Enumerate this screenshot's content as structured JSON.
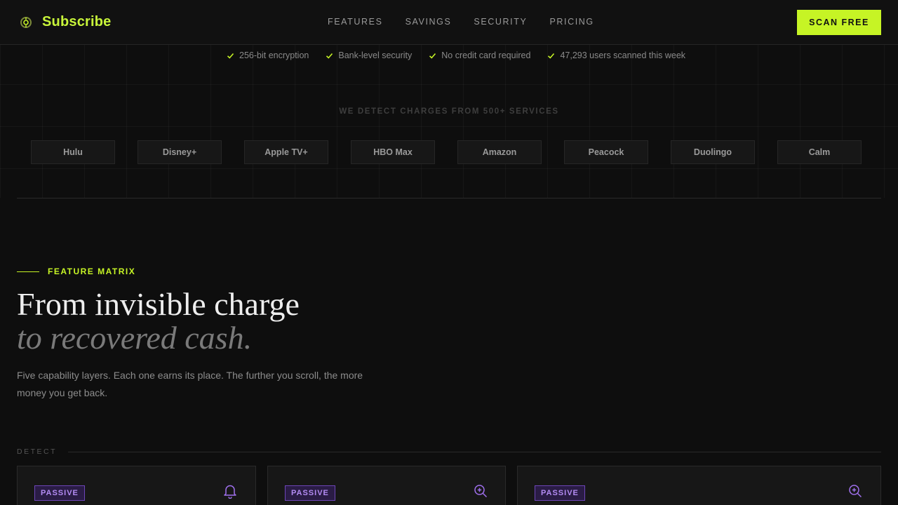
{
  "header": {
    "brand": "Subscribe",
    "nav": [
      "FEATURES",
      "SAVINGS",
      "SECURITY",
      "PRICING"
    ],
    "cta_label": "SCAN FREE"
  },
  "trust": [
    "256-bit encryption",
    "Bank-level security",
    "No credit card required",
    "47,293 users scanned this week"
  ],
  "services": {
    "caption": "WE DETECT CHARGES FROM 500+ SERVICES",
    "items": [
      "Hulu",
      "Disney+",
      "Apple TV+",
      "HBO Max",
      "Amazon",
      "Peacock",
      "Duolingo",
      "Calm"
    ]
  },
  "feature_matrix": {
    "eyebrow": "FEATURE MATRIX",
    "headline_line1": "From invisible charge",
    "headline_line2": "to recovered cash.",
    "subcopy": "Five capability layers. Each one earns its place. The further you scroll, the more money you get back.",
    "section_label": "DETECT",
    "cards": [
      {
        "badge": "PASSIVE",
        "icon": "bell-icon"
      },
      {
        "badge": "PASSIVE",
        "icon": "zoom-in-icon"
      },
      {
        "badge": "PASSIVE",
        "icon": "zoom-in-icon"
      }
    ]
  },
  "colors": {
    "accent": "#c6f425",
    "background": "#0e0e0e",
    "badge_purple": "#b48cf4"
  }
}
